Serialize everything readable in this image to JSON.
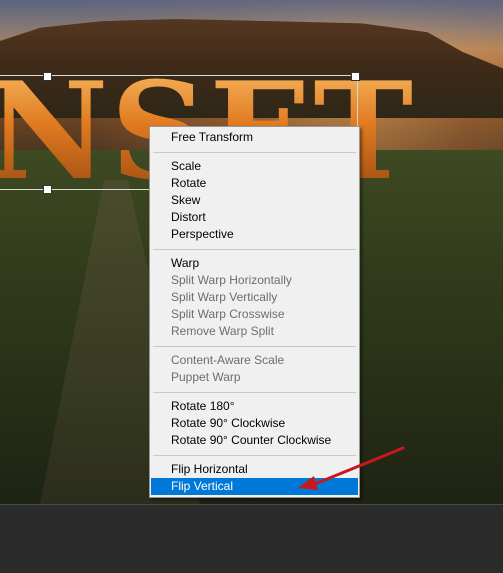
{
  "canvas": {
    "headline_text": "NSET"
  },
  "context_menu": {
    "sections": [
      [
        {
          "label": "Free Transform",
          "enabled": true
        }
      ],
      [
        {
          "label": "Scale",
          "enabled": true
        },
        {
          "label": "Rotate",
          "enabled": true
        },
        {
          "label": "Skew",
          "enabled": true
        },
        {
          "label": "Distort",
          "enabled": true
        },
        {
          "label": "Perspective",
          "enabled": true
        }
      ],
      [
        {
          "label": "Warp",
          "enabled": true
        },
        {
          "label": "Split Warp Horizontally",
          "enabled": false
        },
        {
          "label": "Split Warp Vertically",
          "enabled": false
        },
        {
          "label": "Split Warp Crosswise",
          "enabled": false
        },
        {
          "label": "Remove Warp Split",
          "enabled": false
        }
      ],
      [
        {
          "label": "Content-Aware Scale",
          "enabled": false
        },
        {
          "label": "Puppet Warp",
          "enabled": false
        }
      ],
      [
        {
          "label": "Rotate 180°",
          "enabled": true
        },
        {
          "label": "Rotate 90° Clockwise",
          "enabled": true
        },
        {
          "label": "Rotate 90° Counter Clockwise",
          "enabled": true
        }
      ],
      [
        {
          "label": "Flip Horizontal",
          "enabled": true
        },
        {
          "label": "Flip Vertical",
          "enabled": true,
          "selected": true
        }
      ]
    ]
  },
  "annotation": {
    "arrow_color": "#c8181e"
  },
  "colors": {
    "selection": "#0078d7",
    "menu_background": "#f0f0f0",
    "disabled_text": "#6d6d6d"
  }
}
